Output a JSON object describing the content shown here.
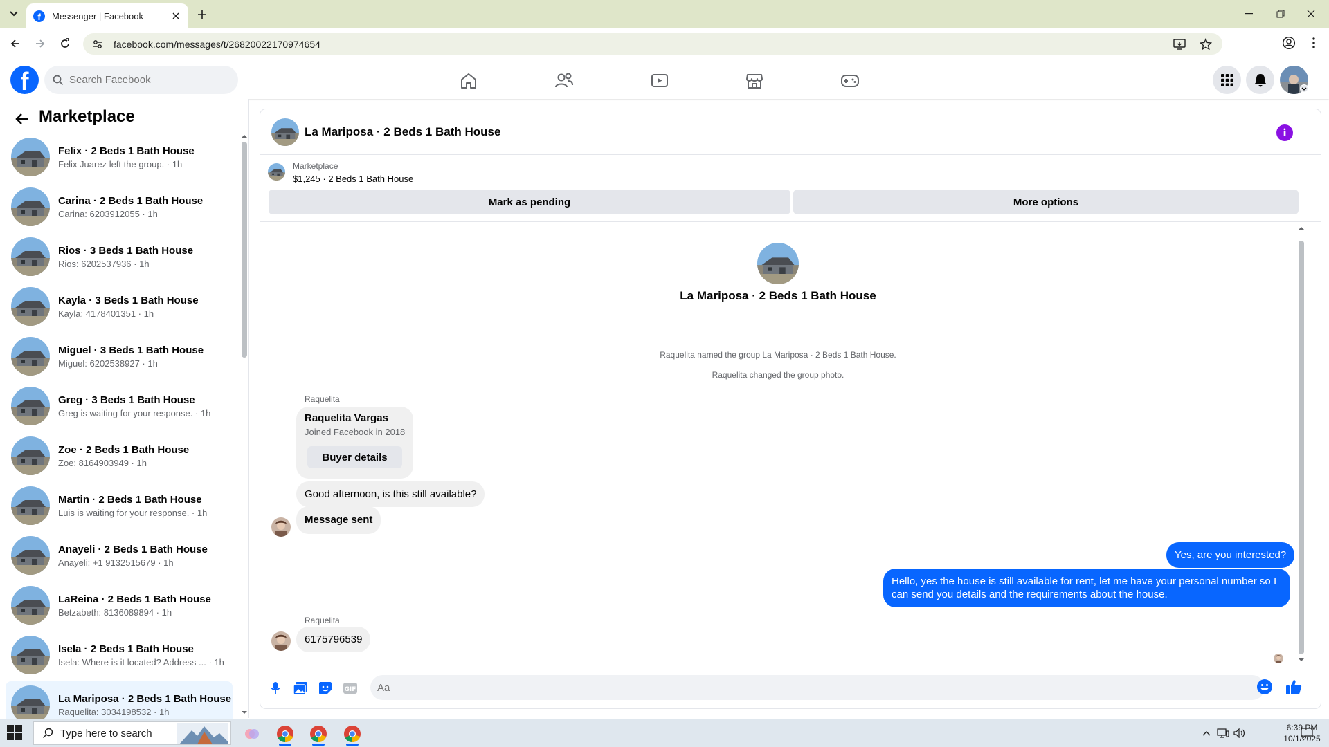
{
  "browser": {
    "tab_title": "Messenger | Facebook",
    "url": "facebook.com/messages/t/26820022170974654",
    "favicon_letter": "f"
  },
  "fb": {
    "logo_letter": "f",
    "search_placeholder": "Search Facebook",
    "brand_color": "#0866ff"
  },
  "sidebar": {
    "title": "Marketplace",
    "conversations": [
      {
        "title": "Felix · 2 Beds 1 Bath House",
        "subtitle": "Felix Juarez left the group. · 1h"
      },
      {
        "title": "Carina · 2 Beds 1 Bath House",
        "subtitle": "Carina: 6203912055 · 1h"
      },
      {
        "title": "Rios · 3 Beds 1 Bath House",
        "subtitle": "Rios: 6202537936 · 1h"
      },
      {
        "title": "Kayla · 3 Beds 1 Bath House",
        "subtitle": "Kayla: 4178401351 · 1h"
      },
      {
        "title": "Miguel · 3 Beds 1 Bath House",
        "subtitle": "Miguel: 6202538927 · 1h"
      },
      {
        "title": "Greg · 3 Beds 1 Bath House",
        "subtitle": "Greg is waiting for your response. · 1h"
      },
      {
        "title": "Zoe · 2 Beds 1 Bath House",
        "subtitle": "Zoe: 8164903949 · 1h"
      },
      {
        "title": "Martin · 2 Beds 1 Bath House",
        "subtitle": "Luis is waiting for your response. · 1h"
      },
      {
        "title": "Anayeli · 2 Beds 1 Bath House",
        "subtitle": "Anayeli: +1 9132515679 · 1h"
      },
      {
        "title": "LaReina · 2 Beds 1 Bath House",
        "subtitle": "Betzabeth: 8136089894 · 1h"
      },
      {
        "title": "Isela · 2 Beds 1 Bath House",
        "subtitle": "Isela: Where is it located? Address ... · 1h"
      },
      {
        "title": "La Mariposa · 2 Beds 1 Bath House",
        "subtitle": "Raquelita: 3034198532 · 1h"
      }
    ]
  },
  "chat": {
    "title": "La Mariposa · 2 Beds 1 Bath House",
    "marketplace_label": "Marketplace",
    "listing": "$1,245 · 2 Beds 1 Bath House",
    "mark_pending": "Mark as pending",
    "more_options": "More options",
    "center_title": "La Mariposa · 2 Beds 1 Bath House",
    "system_1": "Raquelita named the group La Mariposa · 2 Beds 1 Bath House.",
    "system_2": "Raquelita changed the group photo.",
    "sender_1": "Raquelita",
    "card_name": "Raquelita Vargas",
    "card_joined": "Joined Facebook in 2018",
    "buyer_details": "Buyer details",
    "msg_1": "Good afternoon, is this still available?",
    "msg_2": "Message sent",
    "out_1": "Yes, are you interested?",
    "out_2": "Hello, yes the house is still available for rent, let me have your personal number so I can send you details and the requirements about the house.",
    "sender_2": "Raquelita",
    "msg_3": "6175796539",
    "composer_placeholder": "Aa"
  },
  "taskbar": {
    "search_placeholder": "Type here to search",
    "time": "6:39 PM",
    "date": "10/1/2025"
  },
  "icons": [
    "chevron-down-icon",
    "close-icon",
    "plus-icon",
    "back-icon",
    "forward-icon",
    "reload-icon",
    "site-info-icon",
    "install-icon",
    "star-icon",
    "profile-icon",
    "kebab-icon",
    "minimize-icon",
    "maximize-icon",
    "window-close-icon",
    "search-icon",
    "home-icon",
    "friends-icon",
    "video-icon",
    "marketplace-icon",
    "gaming-icon",
    "menu-grid-icon",
    "bell-icon",
    "info-icon",
    "mic-icon",
    "photo-icon",
    "sticker-icon",
    "gif-icon",
    "emoji-icon",
    "like-icon",
    "windows-icon",
    "wifi-icon",
    "volume-icon",
    "notification-icon"
  ]
}
